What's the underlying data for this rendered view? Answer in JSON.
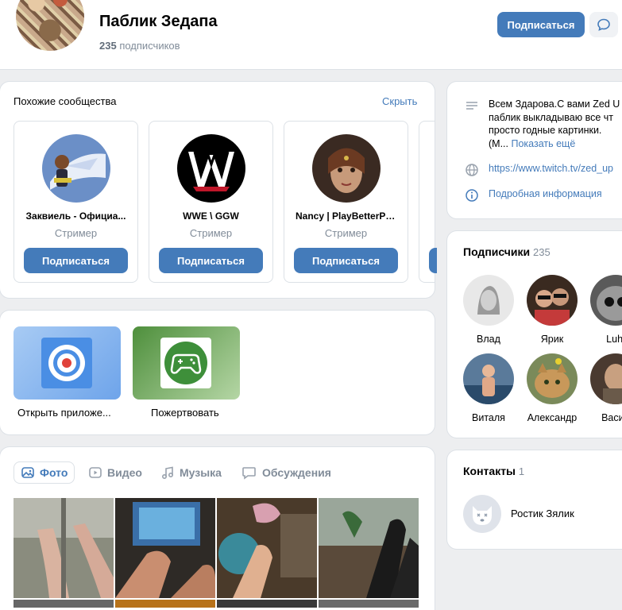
{
  "header": {
    "title": "Паблик Зедапа",
    "subscribers_count": "235",
    "subscribers_label": "подписчиков",
    "subscribe_label": "Подписаться"
  },
  "similar": {
    "title": "Похожие сообщества",
    "hide_label": "Скрыть",
    "items": [
      {
        "name": "Заквиель - Официа...",
        "role": "Стример",
        "button": "Подписаться"
      },
      {
        "name": "WWE \\ GGW",
        "role": "Стример",
        "button": "Подписаться"
      },
      {
        "name": "Nancy | PlayBetterPr...",
        "role": "Стример",
        "button": "Подписаться"
      }
    ]
  },
  "apps": {
    "items": [
      {
        "label": "Открыть приложе..."
      },
      {
        "label": "Пожертвовать"
      }
    ]
  },
  "media": {
    "tabs": [
      {
        "label": "Фото"
      },
      {
        "label": "Видео"
      },
      {
        "label": "Музыка"
      },
      {
        "label": "Обсуждения"
      }
    ]
  },
  "about": {
    "description": "Всем Здарова.С вами Zed U паблик выкладываю все чт просто годные картинки. (М...",
    "more_label": "Показать ещё",
    "link": "https://www.twitch.tv/zed_up",
    "details_label": "Подробная информация"
  },
  "subscribers": {
    "title": "Подписчики",
    "count": "235",
    "items": [
      {
        "name": "Влад"
      },
      {
        "name": "Ярик"
      },
      {
        "name": "Luhi"
      },
      {
        "name": "Виталя"
      },
      {
        "name": "Александр"
      },
      {
        "name": "Васил"
      }
    ]
  },
  "contacts": {
    "title": "Контакты",
    "count": "1",
    "items": [
      {
        "name": "Ростик Зялик"
      }
    ]
  },
  "colors": {
    "accent": "#447bba",
    "background": "#edeef0",
    "muted": "#818c99"
  }
}
